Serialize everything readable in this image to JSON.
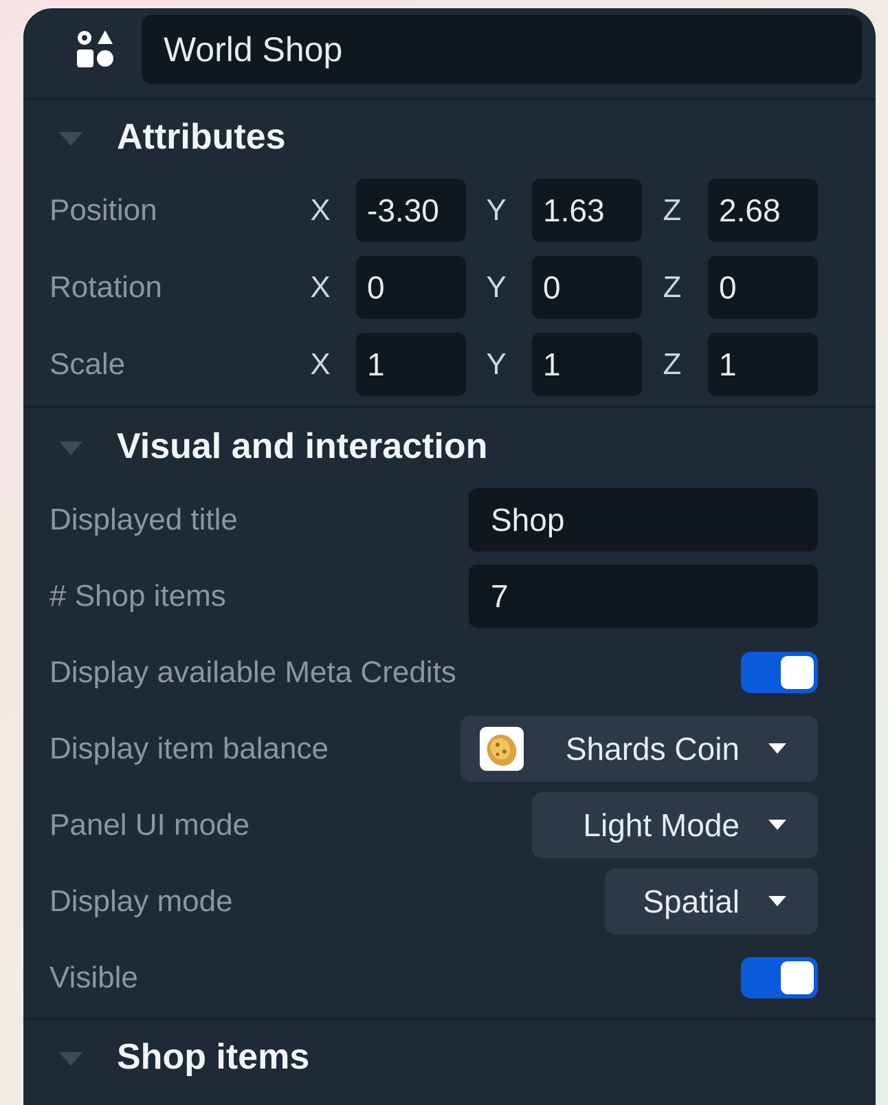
{
  "header": {
    "title": "World Shop",
    "icon": "object-shapes-icon"
  },
  "attributes": {
    "title": "Attributes",
    "rows": [
      {
        "label": "Position",
        "x_label": "X",
        "x": "-3.30",
        "y_label": "Y",
        "y": "1.63",
        "z_label": "Z",
        "z": "2.68"
      },
      {
        "label": "Rotation",
        "x_label": "X",
        "x": "0",
        "y_label": "Y",
        "y": "0",
        "z_label": "Z",
        "z": "0"
      },
      {
        "label": "Scale",
        "x_label": "X",
        "x": "1",
        "y_label": "Y",
        "y": "1",
        "z_label": "Z",
        "z": "1"
      }
    ]
  },
  "visual": {
    "title": "Visual and interaction",
    "displayed_title": {
      "label": "Displayed title",
      "value": "Shop"
    },
    "shop_items_count": {
      "label": "# Shop items",
      "value": "7"
    },
    "display_credits": {
      "label": "Display available Meta Credits",
      "on": true
    },
    "item_balance": {
      "label": "Display item balance",
      "value": "Shards Coin",
      "icon": "coin-icon"
    },
    "panel_ui_mode": {
      "label": "Panel UI mode",
      "value": "Light Mode"
    },
    "display_mode": {
      "label": "Display mode",
      "value": "Spatial"
    },
    "visible": {
      "label": "Visible",
      "on": true
    }
  },
  "shop_items": {
    "title": "Shop items"
  },
  "colors": {
    "panel": "#1e2a35",
    "field": "#10171e",
    "dropdown": "#2c3a47",
    "toggle_on": "#0a5bdc"
  }
}
